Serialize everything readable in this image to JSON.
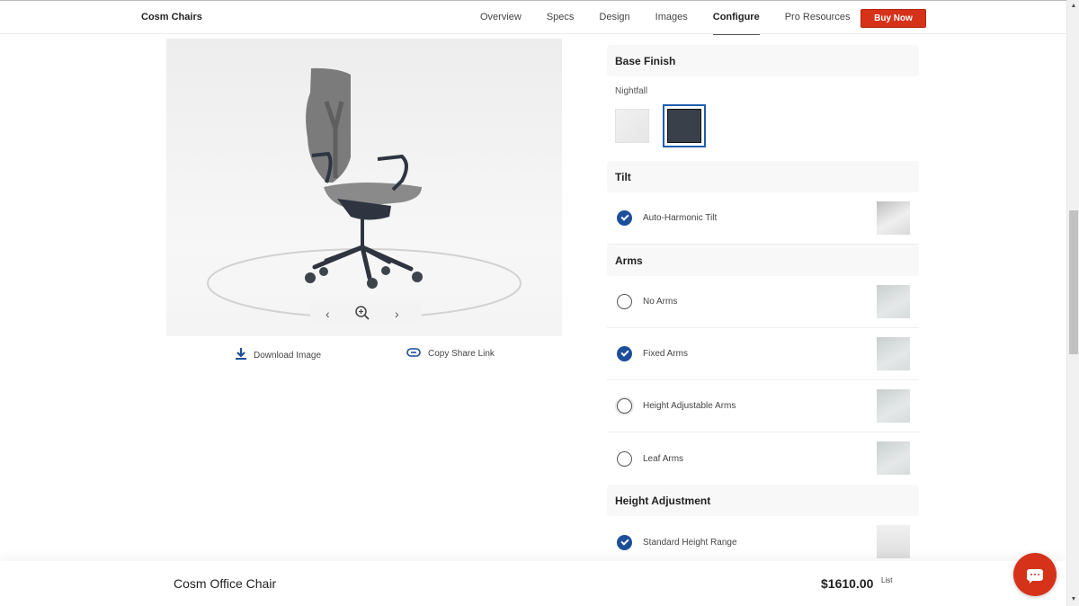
{
  "topnav": {
    "brand": "Cosm Chairs",
    "links": [
      {
        "label": "Overview",
        "active": false
      },
      {
        "label": "Specs",
        "active": false
      },
      {
        "label": "Design",
        "active": false
      },
      {
        "label": "Images",
        "active": false
      },
      {
        "label": "Configure",
        "active": true
      },
      {
        "label": "Pro Resources",
        "active": false
      }
    ],
    "buy_label": "Buy Now",
    "accent_color": "#d6321a"
  },
  "viewer": {
    "prev_icon": "chevron-left-icon",
    "zoom_icon": "zoom-in-icon",
    "next_icon": "chevron-right-icon",
    "actions": {
      "download_label": "Download Image",
      "share_label": "Copy Share Link"
    }
  },
  "config": {
    "base_finish": {
      "title": "Base Finish",
      "selected_name": "Nightfall",
      "swatches": [
        {
          "name": "White",
          "color": "#ececec",
          "selected": false
        },
        {
          "name": "Nightfall",
          "color": "#394049",
          "selected": true
        }
      ]
    },
    "tilt": {
      "title": "Tilt",
      "options": [
        {
          "label": "Auto-Harmonic Tilt",
          "selected": true
        }
      ]
    },
    "arms": {
      "title": "Arms",
      "options": [
        {
          "label": "No Arms",
          "selected": false
        },
        {
          "label": "Fixed Arms",
          "selected": true
        },
        {
          "label": "Height Adjustable Arms",
          "selected": false
        },
        {
          "label": "Leaf Arms",
          "selected": false
        }
      ]
    },
    "height_adjustment": {
      "title": "Height Adjustment",
      "options": [
        {
          "label": "Standard Height Range",
          "selected": true
        }
      ]
    },
    "check_color": "#1d4e9a"
  },
  "footer": {
    "product_name": "Cosm Office Chair",
    "price": "$1610.00",
    "price_tag": "List"
  }
}
